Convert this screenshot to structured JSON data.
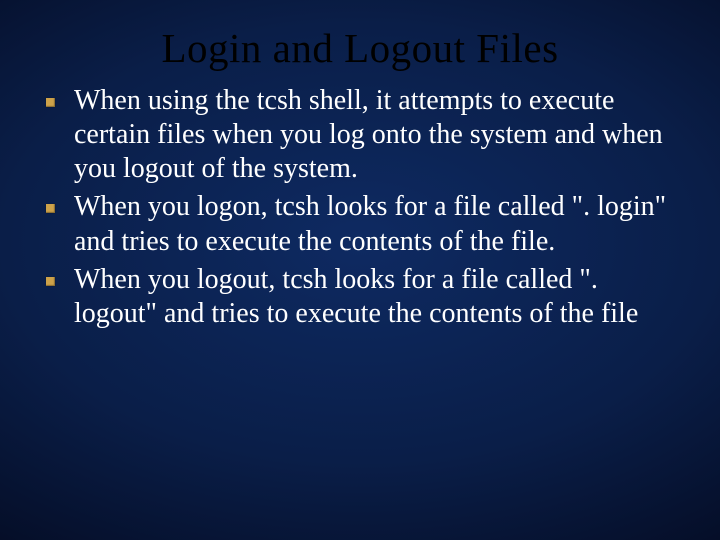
{
  "title": "Login and Logout Files",
  "bullets": [
    {
      "text": "When using the tcsh shell, it attempts to execute certain files when you log onto the system and when you logout of the system."
    },
    {
      "text": "When you logon, tcsh looks for a file called \". login\" and tries to execute the contents of the file."
    },
    {
      "text": "When you logout, tcsh looks for a file called \". logout\" and tries to execute the contents of the file"
    }
  ]
}
